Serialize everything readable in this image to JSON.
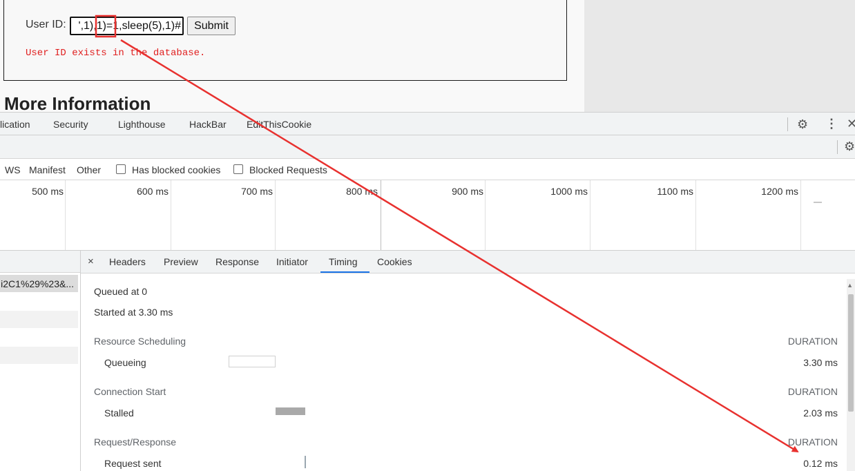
{
  "page": {
    "userid_label": "User ID:",
    "userid_value": "',1),1)=1,sleep(5),1)#",
    "submit_label": "Submit",
    "result_message": "User ID exists in the database.",
    "section_heading": "More Information"
  },
  "devtools_tabs": [
    "lication",
    "Security",
    "Lighthouse",
    "HackBar",
    "EditThisCookie"
  ],
  "devtools_icons": [
    "gear-icon",
    "more-vertical-icon",
    "close-icon"
  ],
  "filter_bar": {
    "types": [
      "WS",
      "Manifest",
      "Other"
    ],
    "checkbox_blocked_cookies": "Has blocked cookies",
    "checkbox_blocked_requests": "Blocked Requests"
  },
  "overview": {
    "ticks": [
      "500 ms",
      "600 ms",
      "700 ms",
      "800 ms",
      "900 ms",
      "1000 ms",
      "1100 ms",
      "1200 ms"
    ]
  },
  "request_list": {
    "selected_row_text": "i2C1%29%23&..."
  },
  "detail_tabs": {
    "close": "×",
    "tabs": [
      "Headers",
      "Preview",
      "Response",
      "Initiator",
      "Timing",
      "Cookies"
    ],
    "active": "Timing"
  },
  "timing": {
    "queued_at": "Queued at 0",
    "started_at": "Started at 3.30 ms",
    "sections": [
      {
        "title": "Resource Scheduling",
        "duration_header": "DURATION",
        "row_label": "Queueing",
        "row_value": "3.30 ms"
      },
      {
        "title": "Connection Start",
        "duration_header": "DURATION",
        "row_label": "Stalled",
        "row_value": "2.03 ms"
      },
      {
        "title": "Request/Response",
        "duration_header": "DURATION",
        "row_label": "Request sent",
        "row_value": "0.12 ms"
      }
    ]
  },
  "annotation": {
    "color": "#e8312f"
  }
}
